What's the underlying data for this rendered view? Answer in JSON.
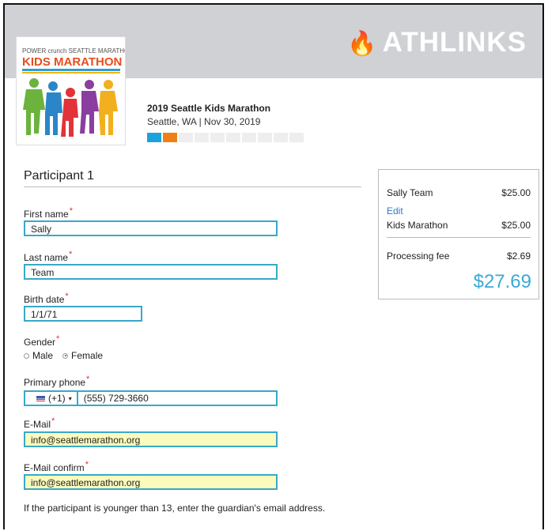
{
  "brand": {
    "name": "ATHLINKS",
    "icon": "flame-icon"
  },
  "event": {
    "logo_top": "POWER crunch SEATTLE MARATHON",
    "logo_title": "KIDS MARATHON",
    "name": "2019 Seattle Kids Marathon",
    "location_date": "Seattle, WA | Nov 30, 2019",
    "progress": {
      "completed_steps": 2,
      "total_steps": 10
    }
  },
  "form": {
    "title": "Participant 1",
    "required_mark": "*",
    "first_name": {
      "label": "First name",
      "value": "Sally"
    },
    "last_name": {
      "label": "Last name",
      "value": "Team"
    },
    "birth_date": {
      "label": "Birth date",
      "value": "1/1/71"
    },
    "gender": {
      "label": "Gender",
      "options": [
        "Male",
        "Female"
      ],
      "selected": "Female"
    },
    "phone": {
      "label": "Primary phone",
      "country_code": "(+1)",
      "value": "(555) 729-3660"
    },
    "email": {
      "label": "E-Mail",
      "value": "info@seattlemarathon.org"
    },
    "email_confirm": {
      "label": "E-Mail confirm",
      "value": "info@seattlemarathon.org"
    },
    "note": "If the participant is younger than 13, enter the guardian's email address."
  },
  "summary": {
    "participant": "Sally Team",
    "participant_price": "$25.00",
    "edit_label": "Edit",
    "item": "Kids Marathon",
    "item_price": "$25.00",
    "fee_label": "Processing fee",
    "fee_price": "$2.69",
    "total": "$27.69"
  },
  "colors": {
    "accent": "#39a8c8",
    "header_bg": "#cfd1d4",
    "total": "#3aa9d6",
    "link": "#2e7bc4",
    "highlight": "#fbfbbd"
  }
}
